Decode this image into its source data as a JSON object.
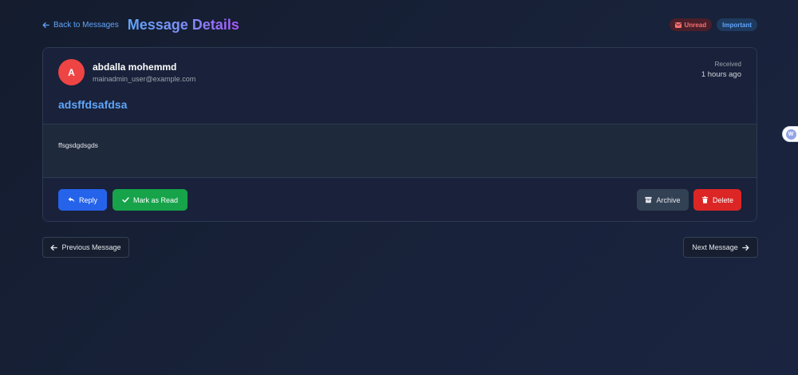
{
  "header": {
    "back_label": "Back to Messages",
    "title": "Message Details",
    "badges": {
      "unread": "Unread",
      "important": "Important"
    }
  },
  "message": {
    "sender": {
      "initial": "A",
      "name": "abdalla mohemmd",
      "email": "mainadmin_user@example.com"
    },
    "received_label": "Received",
    "received_time": "1 hours ago",
    "subject": "adsffdsafdsa",
    "body": "ffsgsdgdsgds"
  },
  "actions": {
    "reply": "Reply",
    "mark_read": "Mark as Read",
    "archive": "Archive",
    "delete": "Delete"
  },
  "navigation": {
    "previous": "Previous Message",
    "next": "Next Message"
  },
  "side_widget": {
    "glyph": "W"
  },
  "colors": {
    "accent_blue": "#60a5fa",
    "title_gradient_end": "#a855f7",
    "avatar": "#ef4444",
    "reply_button": "#2563eb",
    "mark_read_button": "#16a34a",
    "archive_button": "#334155",
    "delete_button": "#dc2626",
    "unread_badge_text": "#f87171",
    "background": "#141c2e"
  },
  "icons": {
    "back": "arrow-left-icon",
    "unread": "envelope-icon",
    "reply": "reply-icon",
    "mark_read": "check-icon",
    "archive": "archive-box-icon",
    "delete": "trash-icon",
    "previous": "arrow-left-icon",
    "next": "arrow-right-icon"
  }
}
